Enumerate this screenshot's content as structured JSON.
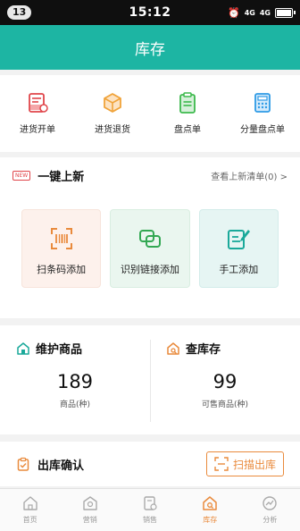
{
  "status_bar": {
    "notification_count": "13",
    "time": "15:12",
    "signal1": "4G",
    "signal2": "4G"
  },
  "header": {
    "title": "库存"
  },
  "quick_actions": [
    {
      "label": "进货开单",
      "icon": "purchase-order-icon",
      "color": "#e0454a"
    },
    {
      "label": "进货退货",
      "icon": "box-icon",
      "color": "#f0a33a"
    },
    {
      "label": "盘点单",
      "icon": "clipboard-icon",
      "color": "#3cb94c"
    },
    {
      "label": "分量盘点单",
      "icon": "calculator-icon",
      "color": "#2e9be6"
    }
  ],
  "new_listing": {
    "badge": "NEW",
    "title": "一键上新",
    "link": "查看上新清单(0) >",
    "cards": [
      {
        "label": "扫条码添加",
        "icon": "scan-barcode-icon",
        "color": "#e98a3c"
      },
      {
        "label": "识别链接添加",
        "icon": "link-icon",
        "color": "#33a853"
      },
      {
        "label": "手工添加",
        "icon": "edit-icon",
        "color": "#1aa99a"
      }
    ]
  },
  "stats": {
    "maintain": {
      "title": "维护商品",
      "value": "189",
      "sub": "商品(种)"
    },
    "inventory": {
      "title": "查库存",
      "value": "99",
      "sub": "可售商品(种)"
    }
  },
  "outbound": {
    "title": "出库确认",
    "button": "扫描出库"
  },
  "tabbar": {
    "items": [
      {
        "label": "首页",
        "icon": "home-icon"
      },
      {
        "label": "营销",
        "icon": "marketing-icon"
      },
      {
        "label": "销售",
        "icon": "sales-icon"
      },
      {
        "label": "库存",
        "icon": "inventory-icon",
        "active": true
      },
      {
        "label": "分析",
        "icon": "analysis-icon"
      }
    ],
    "active_color": "#e98a3c"
  },
  "colors": {
    "brand": "#1db5a3",
    "accent": "#e98a3c"
  }
}
